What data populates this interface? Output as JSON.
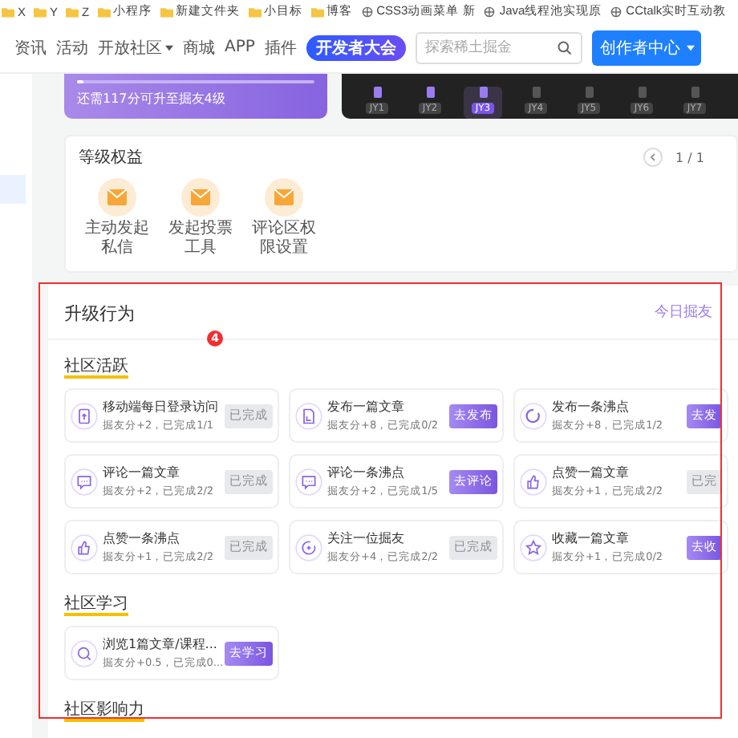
{
  "bookmarks": [
    "X",
    "Y",
    "Z",
    "小程序",
    "新建文件夹",
    "小目标",
    "博客",
    "CSS3动画菜单 新",
    "Java线程池实现原",
    "CCtalk实时互动教"
  ],
  "nav": {
    "items": [
      {
        "label": "资讯",
        "dropdown": false
      },
      {
        "label": "活动",
        "dropdown": false
      },
      {
        "label": "开放社区",
        "dropdown": true
      },
      {
        "label": "商城",
        "dropdown": false
      },
      {
        "label": "APP",
        "dropdown": false
      },
      {
        "label": "插件",
        "dropdown": false
      }
    ],
    "event_badge": "开发者大会",
    "search": {
      "placeholder": "探索稀土掘金"
    },
    "creator_button": "创作者中心"
  },
  "level_card": {
    "level": 0.03,
    "hint": "还需117分可升至掘友4级"
  },
  "levels": [
    {
      "label": "JY1",
      "reached": true,
      "selected": false
    },
    {
      "label": "JY2",
      "reached": true,
      "selected": false
    },
    {
      "label": "JY3",
      "reached": true,
      "selected": true
    },
    {
      "label": "JY4",
      "reached": false,
      "selected": false
    },
    {
      "label": "JY5",
      "reached": false,
      "selected": false
    },
    {
      "label": "JY6",
      "reached": false,
      "selected": false
    },
    {
      "label": "JY7",
      "reached": false,
      "selected": false
    }
  ],
  "benefits": {
    "title": "等级权益",
    "pager": "1 / 1",
    "items": [
      "主动发起私信",
      "发起投票工具",
      "评论区权限设置"
    ]
  },
  "upgrade": {
    "title": "升级行为",
    "badge": "4",
    "link": "今日掘友",
    "sections": [
      {
        "title": "社区活跃",
        "tasks": [
          {
            "title": "移动端每日登录访问",
            "desc": "掘友分+2，已完成1/1",
            "button": "已完成",
            "done": true
          },
          {
            "title": "发布一篇文章",
            "desc": "掘友分+8，已完成0/2",
            "button": "去发布",
            "done": false
          },
          {
            "title": "发布一条沸点",
            "desc": "掘友分+8，已完成1/2",
            "button": "去发",
            "done": false
          },
          {
            "title": "评论一篇文章",
            "desc": "掘友分+2，已完成2/2",
            "button": "已完成",
            "done": true
          },
          {
            "title": "评论一条沸点",
            "desc": "掘友分+2，已完成1/5",
            "button": "去评论",
            "done": false
          },
          {
            "title": "点赞一篇文章",
            "desc": "掘友分+1，已完成2/2",
            "button": "已完",
            "done": true
          },
          {
            "title": "点赞一条沸点",
            "desc": "掘友分+1，已完成2/2",
            "button": "已完成",
            "done": true
          },
          {
            "title": "关注一位掘友",
            "desc": "掘友分+4，已完成2/2",
            "button": "已完成",
            "done": true
          },
          {
            "title": "收藏一篇文章",
            "desc": "掘友分+1，已完成0/2",
            "button": "去收",
            "done": false
          }
        ]
      },
      {
        "title": "社区学习",
        "tasks": [
          {
            "title": "浏览1篇文章/课程...",
            "desc": "掘友分+0.5，已完成0...",
            "button": "去学习",
            "done": false
          }
        ]
      },
      {
        "title": "社区影响力"
      }
    ]
  }
}
